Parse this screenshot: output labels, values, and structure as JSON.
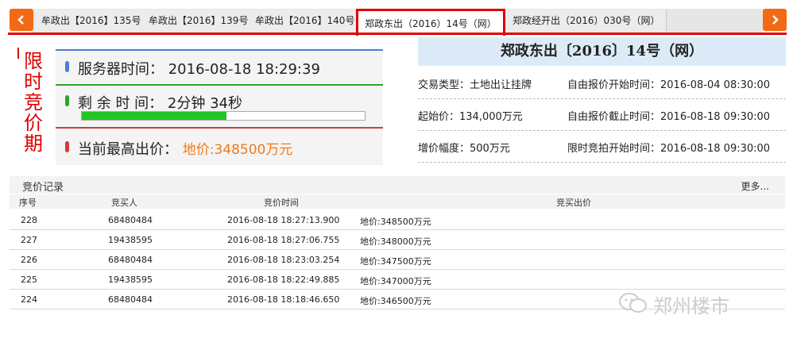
{
  "tabs": [
    {
      "label": "牟政出【2016】135号"
    },
    {
      "label": "牟政出【2016】139号"
    },
    {
      "label": "牟政出【2016】140号"
    },
    {
      "label": "郑政东出（2016）14号（网）"
    },
    {
      "label": "郑政经开出（2016）030号（网）"
    }
  ],
  "active_tab_index": 3,
  "vertical_title": "限时竞价期",
  "left_panel": {
    "server_time_label": "服务器时间：",
    "server_time_value": "2016-08-18 18:29:39",
    "remain_label": "剩 余 时 间：",
    "remain_value": "2分钟 34秒",
    "remain_progress_fraction": 0.51,
    "price_label": "当前最高出价：",
    "price_value": "地价:348500万元"
  },
  "right_panel": {
    "title": "郑政东出〔2016〕14号（网）",
    "trade_type": "交易类型：土地出让挂牌",
    "start_price": "起始价：134,000万元",
    "increment": "增价幅度：500万元",
    "free_start": "自由报价开始时间：2016-08-04 08:30:00",
    "free_end": "自由报价截止时间：2016-08-18 09:30:00",
    "limit_start": "限时竞拍开始时间：2016-08-18 09:30:00"
  },
  "records": {
    "title": "竞价记录",
    "more": "更多...",
    "columns": [
      "序号",
      "竞买人",
      "竞价时间",
      "竞买出价"
    ],
    "rows": [
      {
        "no": "228",
        "bidder": "68480484",
        "time": "2016-08-18 18:27:13.900",
        "price": "地价:348500万元"
      },
      {
        "no": "227",
        "bidder": "19438595",
        "time": "2016-08-18 18:27:06.755",
        "price": "地价:348000万元"
      },
      {
        "no": "226",
        "bidder": "68480484",
        "time": "2016-08-18 18:23:03.254",
        "price": "地价:347500万元"
      },
      {
        "no": "225",
        "bidder": "19438595",
        "time": "2016-08-18 18:22:49.885",
        "price": "地价:347000万元"
      },
      {
        "no": "224",
        "bidder": "68480484",
        "time": "2016-08-18 18:18:46.650",
        "price": "地价:346500万元"
      }
    ]
  },
  "watermark": "郑州楼市",
  "colors": {
    "accent_red": "#e00000",
    "nav_orange": "#f26a16",
    "price_orange": "#f07a1a",
    "progress_green": "#23c423"
  }
}
